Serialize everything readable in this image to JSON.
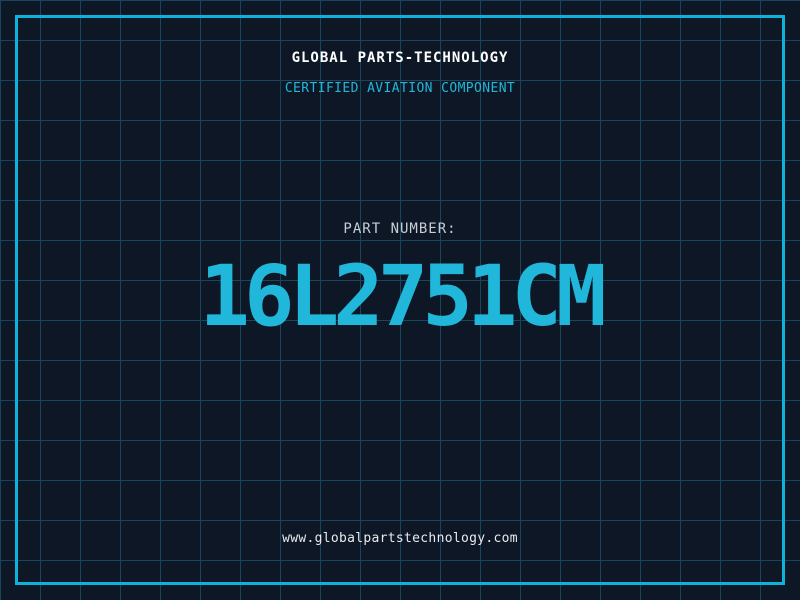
{
  "brand": {
    "title": "GLOBAL PARTS-TECHNOLOGY",
    "subtitle": "CERTIFIED AVIATION COMPONENT"
  },
  "part": {
    "label": "PART NUMBER:",
    "number": "16L2751CM"
  },
  "footer": {
    "website": "www.globalpartstechnology.com"
  },
  "colors": {
    "background": "#0e1726",
    "grid-line": "#17465f",
    "frame": "#0cb2da",
    "accent": "#20b7da",
    "title": "#ffffff",
    "label": "#c9ced6",
    "footer-text": "#e9eaee"
  }
}
